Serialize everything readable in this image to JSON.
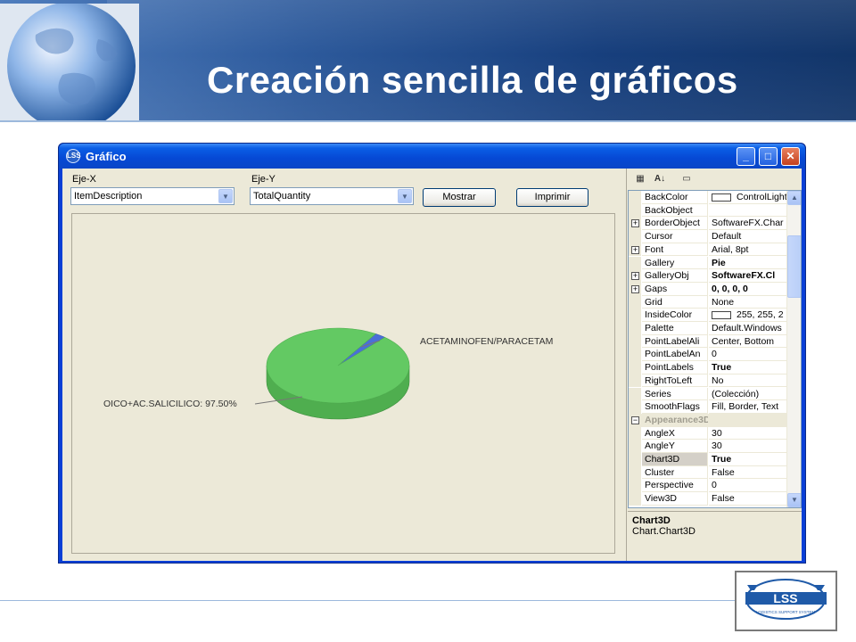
{
  "slide": {
    "title": "Creación sencilla de gráficos",
    "logo_text": "LSS",
    "logo_subtitle": "LOGISTICS SUPPORT SYSTEM"
  },
  "window": {
    "title": "Gráfico",
    "app_icon": "LSS",
    "controls": {
      "minimize": "_",
      "maximize": "□",
      "close": "✕"
    }
  },
  "toolbar": {
    "x_axis_label": "Eje-X",
    "x_axis_value": "ItemDescription",
    "y_axis_label": "Eje-Y",
    "y_axis_value": "TotalQuantity",
    "show_button": "Mostrar",
    "print_button": "Imprimir"
  },
  "chart_data": {
    "type": "pie",
    "style": "3D",
    "labels": [
      "OICO+AC.SALICILICO: 97.50%",
      "ACETAMINOFEN/PARACETAM"
    ],
    "values": [
      97.5,
      2.5
    ],
    "colors": [
      "#63c963",
      "#4a6fd8"
    ]
  },
  "property_grid": {
    "tools": {
      "categorized": "categorized-icon",
      "alphabetical": "sort-az-icon",
      "pages": "property-pages-icon"
    },
    "rows": [
      {
        "name": "BackColor",
        "value": "ControlLight",
        "swatch": true,
        "expand": "",
        "bold": false,
        "category": false
      },
      {
        "name": "BackObject",
        "value": "",
        "swatch": false,
        "expand": "",
        "bold": false,
        "category": false
      },
      {
        "name": "BorderObject",
        "value": "SoftwareFX.Char",
        "swatch": false,
        "expand": "+",
        "bold": false,
        "category": false
      },
      {
        "name": "Cursor",
        "value": "Default",
        "swatch": false,
        "expand": "",
        "bold": false,
        "category": false
      },
      {
        "name": "Font",
        "value": "Arial, 8pt",
        "swatch": false,
        "expand": "+",
        "bold": false,
        "category": false
      },
      {
        "name": "Gallery",
        "value": "Pie",
        "swatch": false,
        "expand": "",
        "bold": true,
        "category": false
      },
      {
        "name": "GalleryObj",
        "value": "SoftwareFX.Cl",
        "swatch": false,
        "expand": "+",
        "bold": true,
        "category": false
      },
      {
        "name": "Gaps",
        "value": "0, 0, 0, 0",
        "swatch": false,
        "expand": "+",
        "bold": true,
        "category": false
      },
      {
        "name": "Grid",
        "value": "None",
        "swatch": false,
        "expand": "",
        "bold": false,
        "category": false
      },
      {
        "name": "InsideColor",
        "value": "255, 255, 2",
        "swatch": true,
        "expand": "",
        "bold": false,
        "category": false
      },
      {
        "name": "Palette",
        "value": "Default.Windows",
        "swatch": false,
        "expand": "",
        "bold": false,
        "category": false
      },
      {
        "name": "PointLabelAli",
        "value": "Center, Bottom",
        "swatch": false,
        "expand": "",
        "bold": false,
        "category": false
      },
      {
        "name": "PointLabelAn",
        "value": "0",
        "swatch": false,
        "expand": "",
        "bold": false,
        "category": false
      },
      {
        "name": "PointLabels",
        "value": "True",
        "swatch": false,
        "expand": "",
        "bold": true,
        "category": false
      },
      {
        "name": "RightToLeft",
        "value": "No",
        "swatch": false,
        "expand": "",
        "bold": false,
        "category": false
      },
      {
        "name": "Series",
        "value": "(Colección)",
        "swatch": false,
        "expand": "",
        "bold": false,
        "category": false
      },
      {
        "name": "SmoothFlags",
        "value": "Fill, Border, Text",
        "swatch": false,
        "expand": "",
        "bold": false,
        "category": false
      },
      {
        "name": "Appearance3D",
        "value": "",
        "swatch": false,
        "expand": "−",
        "bold": true,
        "category": true
      },
      {
        "name": "AngleX",
        "value": "30",
        "swatch": false,
        "expand": "",
        "bold": false,
        "category": false
      },
      {
        "name": "AngleY",
        "value": "30",
        "swatch": false,
        "expand": "",
        "bold": false,
        "category": false
      },
      {
        "name": "Chart3D",
        "value": "True",
        "swatch": false,
        "expand": "",
        "bold": true,
        "category": false,
        "selected": true
      },
      {
        "name": "Cluster",
        "value": "False",
        "swatch": false,
        "expand": "",
        "bold": false,
        "category": false
      },
      {
        "name": "Perspective",
        "value": "0",
        "swatch": false,
        "expand": "",
        "bold": false,
        "category": false
      },
      {
        "name": "View3D",
        "value": "False",
        "swatch": false,
        "expand": "",
        "bold": false,
        "category": false
      }
    ],
    "description_title": "Chart3D",
    "description_text": "Chart.Chart3D"
  }
}
